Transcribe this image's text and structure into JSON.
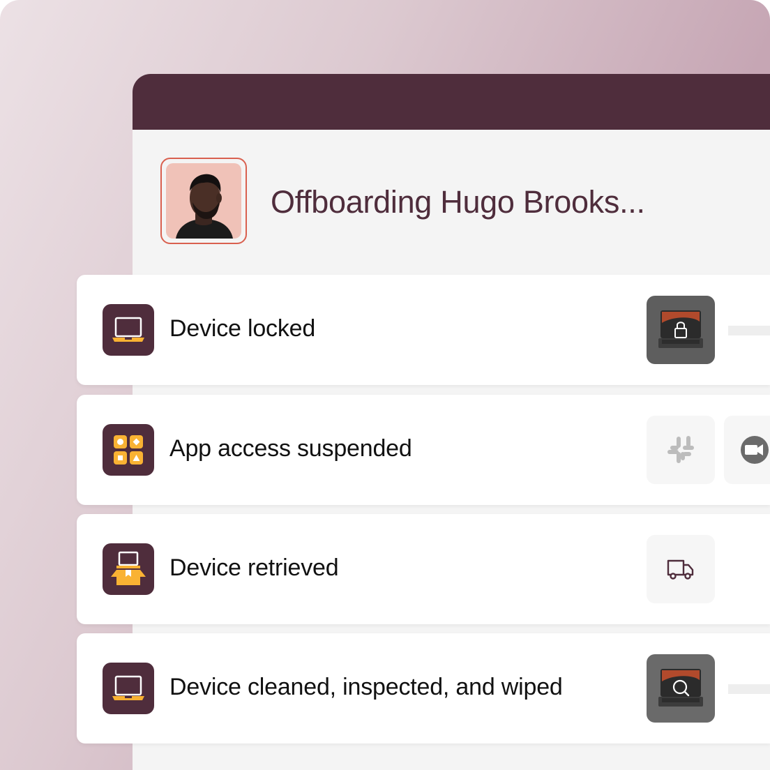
{
  "header": {
    "title": "Offboarding Hugo Brooks..."
  },
  "colors": {
    "brand": "#4f2d3c",
    "accent": "#f9b233",
    "avatar_border": "#d9604f",
    "avatar_bg": "#f0c2b8"
  },
  "steps": [
    {
      "label": "Device locked",
      "icon": "laptop-icon",
      "preview": "laptop-lock-icon"
    },
    {
      "label": "App access suspended",
      "icon": "apps-grid-icon",
      "preview": [
        "slack-icon",
        "video-call-icon"
      ]
    },
    {
      "label": "Device retrieved",
      "icon": "laptop-box-icon",
      "preview": "delivery-truck-icon"
    },
    {
      "label": "Device cleaned, inspected, and wiped",
      "icon": "laptop-icon",
      "preview": "laptop-inspect-icon"
    }
  ]
}
